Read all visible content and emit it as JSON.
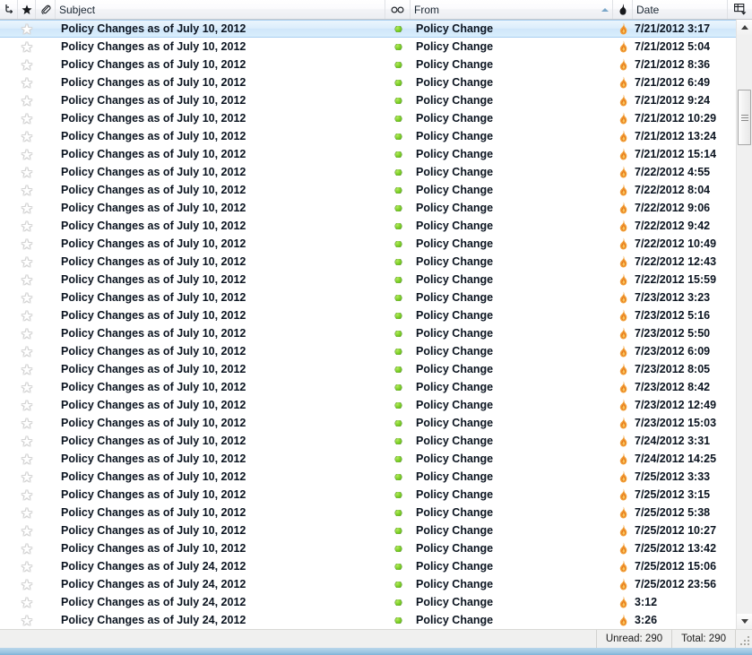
{
  "columns": {
    "thread_icon": "thread-icon",
    "star_icon": "star-icon",
    "attachment_icon": "paperclip-icon",
    "subject_label": "Subject",
    "unread_icon": "unread-status-icon",
    "from_label": "From",
    "from_sort": "ascending",
    "flame_icon": "flame-icon",
    "date_label": "Date",
    "picker_icon": "column-picker-icon"
  },
  "rows": [
    {
      "subject": "Policy Changes as of July 10, 2012",
      "from": "Policy Change",
      "date": "7/21/2012 3:17",
      "selected": true
    },
    {
      "subject": "Policy Changes as of July 10, 2012",
      "from": "Policy Change",
      "date": "7/21/2012 5:04",
      "selected": false
    },
    {
      "subject": "Policy Changes as of July 10, 2012",
      "from": "Policy Change",
      "date": "7/21/2012 8:36",
      "selected": false
    },
    {
      "subject": "Policy Changes as of July 10, 2012",
      "from": "Policy Change",
      "date": "7/21/2012 6:49",
      "selected": false
    },
    {
      "subject": "Policy Changes as of July 10, 2012",
      "from": "Policy Change",
      "date": "7/21/2012 9:24",
      "selected": false
    },
    {
      "subject": "Policy Changes as of July 10, 2012",
      "from": "Policy Change",
      "date": "7/21/2012 10:29",
      "selected": false
    },
    {
      "subject": "Policy Changes as of July 10, 2012",
      "from": "Policy Change",
      "date": "7/21/2012 13:24",
      "selected": false
    },
    {
      "subject": "Policy Changes as of July 10, 2012",
      "from": "Policy Change",
      "date": "7/21/2012 15:14",
      "selected": false
    },
    {
      "subject": "Policy Changes as of July 10, 2012",
      "from": "Policy Change",
      "date": "7/22/2012 4:55",
      "selected": false
    },
    {
      "subject": "Policy Changes as of July 10, 2012",
      "from": "Policy Change",
      "date": "7/22/2012 8:04",
      "selected": false
    },
    {
      "subject": "Policy Changes as of July 10, 2012",
      "from": "Policy Change",
      "date": "7/22/2012 9:06",
      "selected": false
    },
    {
      "subject": "Policy Changes as of July 10, 2012",
      "from": "Policy Change",
      "date": "7/22/2012 9:42",
      "selected": false
    },
    {
      "subject": "Policy Changes as of July 10, 2012",
      "from": "Policy Change",
      "date": "7/22/2012 10:49",
      "selected": false
    },
    {
      "subject": "Policy Changes as of July 10, 2012",
      "from": "Policy Change",
      "date": "7/22/2012 12:43",
      "selected": false
    },
    {
      "subject": "Policy Changes as of July 10, 2012",
      "from": "Policy Change",
      "date": "7/22/2012 15:59",
      "selected": false
    },
    {
      "subject": "Policy Changes as of July 10, 2012",
      "from": "Policy Change",
      "date": "7/23/2012 3:23",
      "selected": false
    },
    {
      "subject": "Policy Changes as of July 10, 2012",
      "from": "Policy Change",
      "date": "7/23/2012 5:16",
      "selected": false
    },
    {
      "subject": "Policy Changes as of July 10, 2012",
      "from": "Policy Change",
      "date": "7/23/2012 5:50",
      "selected": false
    },
    {
      "subject": "Policy Changes as of July 10, 2012",
      "from": "Policy Change",
      "date": "7/23/2012 6:09",
      "selected": false
    },
    {
      "subject": "Policy Changes as of July 10, 2012",
      "from": "Policy Change",
      "date": "7/23/2012 8:05",
      "selected": false
    },
    {
      "subject": "Policy Changes as of July 10, 2012",
      "from": "Policy Change",
      "date": "7/23/2012 8:42",
      "selected": false
    },
    {
      "subject": "Policy Changes as of July 10, 2012",
      "from": "Policy Change",
      "date": "7/23/2012 12:49",
      "selected": false
    },
    {
      "subject": "Policy Changes as of July 10, 2012",
      "from": "Policy Change",
      "date": "7/23/2012 15:03",
      "selected": false
    },
    {
      "subject": "Policy Changes as of July 10, 2012",
      "from": "Policy Change",
      "date": "7/24/2012 3:31",
      "selected": false
    },
    {
      "subject": "Policy Changes as of July 10, 2012",
      "from": "Policy Change",
      "date": "7/24/2012 14:25",
      "selected": false
    },
    {
      "subject": "Policy Changes as of July 10, 2012",
      "from": "Policy Change",
      "date": "7/25/2012 3:33",
      "selected": false
    },
    {
      "subject": "Policy Changes as of July 10, 2012",
      "from": "Policy Change",
      "date": "7/25/2012 3:15",
      "selected": false
    },
    {
      "subject": "Policy Changes as of July 10, 2012",
      "from": "Policy Change",
      "date": "7/25/2012 5:38",
      "selected": false
    },
    {
      "subject": "Policy Changes as of July 10, 2012",
      "from": "Policy Change",
      "date": "7/25/2012 10:27",
      "selected": false
    },
    {
      "subject": "Policy Changes as of July 10, 2012",
      "from": "Policy Change",
      "date": "7/25/2012 13:42",
      "selected": false
    },
    {
      "subject": "Policy Changes as of July 24, 2012",
      "from": "Policy Change",
      "date": "7/25/2012 15:06",
      "selected": false
    },
    {
      "subject": "Policy Changes as of July 24, 2012",
      "from": "Policy Change",
      "date": "7/25/2012 23:56",
      "selected": false
    },
    {
      "subject": "Policy Changes as of July 24, 2012",
      "from": "Policy Change",
      "date": "3:12",
      "selected": false
    },
    {
      "subject": "Policy Changes as of July 24, 2012",
      "from": "Policy Change",
      "date": "3:26",
      "selected": false
    }
  ],
  "statusbar": {
    "unread": "Unread: 290",
    "total": "Total: 290"
  },
  "colors": {
    "selection": "#cfe6fa",
    "selection_border": "#a7cdf0",
    "unread_dot": "#77cc22",
    "flame": "#f08a1c",
    "sort_arrow": "#7ba7c9",
    "window_border": "#9ec6e2"
  }
}
